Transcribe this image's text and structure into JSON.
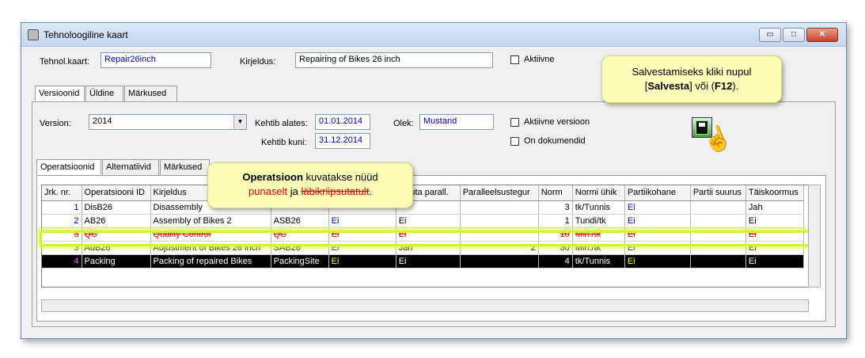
{
  "window": {
    "title": "Tehnoloogiline kaart",
    "buttons": {
      "minimize": "▭",
      "maximize": "□",
      "close": "✕"
    }
  },
  "header": {
    "tehnol_label": "Tehnol.kaart:",
    "tehnol_value": "Repair26inch",
    "kirjeldus_label": "Kirjeldus:",
    "kirjeldus_value": "Repairing of Bikes 26 inch",
    "aktiivne_label": "Aktiivne"
  },
  "main_tabs": [
    "Versioonid",
    "Üldine",
    "Märkused"
  ],
  "version": {
    "version_label": "Version:",
    "version_value": "2014",
    "kehtib_alates_label": "Kehtib alates:",
    "kehtib_alates_value": "01.01.2014",
    "kehtib_kuni_label": "Kehtib kuni:",
    "kehtib_kuni_value": "31.12.2014",
    "olek_label": "Olek:",
    "olek_value": "Mustand",
    "aktiivne_version_label": "Aktiivne versioon",
    "on_dokumendid_label": "On dokumendid"
  },
  "sub_tabs": [
    "Operatsioonid",
    "Alternatiivid",
    "Märkused"
  ],
  "grid": {
    "columns": [
      "Jrk. nr.",
      "Operatsiooni ID",
      "Kirjeldus",
      "",
      "",
      "...suta parall.",
      "Paralleelsustegur",
      "Norm",
      "Normi ühik",
      "Partiikohane",
      "Partii suurus",
      "Täiskoormus"
    ],
    "rows": [
      [
        "1",
        "DisB26",
        "Disassembly",
        "",
        "",
        "",
        "",
        "3",
        "tk/Tunnis",
        "Ei",
        "",
        "Jah"
      ],
      [
        "2",
        "AB26",
        "Assembly of Bikes 2",
        "ASB26",
        "Ei",
        "Ei",
        "",
        "1",
        "Tundi/tk",
        "Ei",
        "",
        "Ei"
      ],
      [
        "3",
        "QC",
        "Quality Control",
        "QC",
        "Ei",
        "Ei",
        "",
        "10",
        "Min./tk",
        "Ei",
        "",
        "Ei"
      ],
      [
        "3",
        "AdB26",
        "Adjustment of Bikes 26 inch",
        "SAB26",
        "Ei",
        "Jah",
        "2",
        "30",
        "Min./tk",
        "Ei",
        "",
        "Ei"
      ],
      [
        "4",
        "Packing",
        "Packing of repaired Bikes",
        "PackingSite",
        "Ei",
        "Ei",
        "",
        "4",
        "tk/Tunnis",
        "Ei",
        "",
        "Ei"
      ]
    ]
  },
  "callout_ops": {
    "bold": "Operatsioon",
    "text1": " kuvatakse nüüd",
    "red": "punaselt",
    "text2": " ja ",
    "strike": "läbikriipsutatult",
    "end": "."
  },
  "callout_save": {
    "line1": "Salvestamiseks kliki nupul",
    "bracket_open": "[",
    "bold1": "Salvesta",
    "mid": "] või (",
    "bold2": "F12",
    "close": ")."
  },
  "colors": {
    "accent_red": "#e00000",
    "callout_bg": "#fdfdb8",
    "highlight": "#d8f03a"
  }
}
